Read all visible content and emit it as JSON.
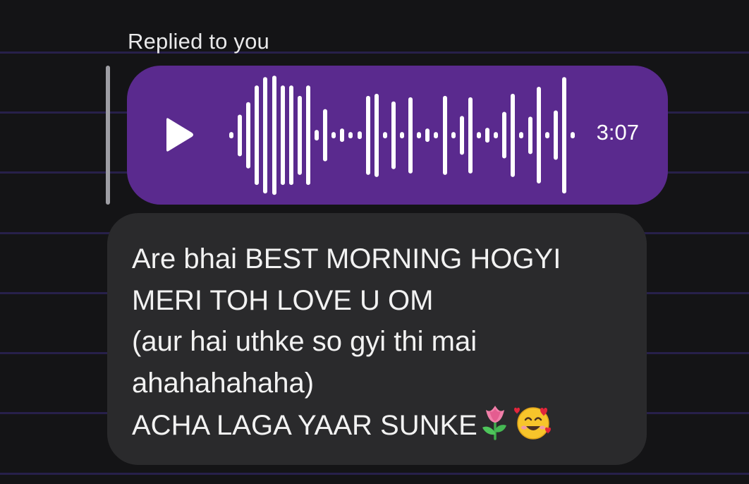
{
  "reply": {
    "label": "Replied to you"
  },
  "voice_message": {
    "duration": "3:07",
    "play_icon": "play-icon",
    "waveform_bars_level": [
      0.05,
      0.3,
      0.48,
      0.72,
      0.84,
      0.86,
      0.72,
      0.72,
      0.57,
      0.72,
      0.08,
      0.38,
      0.05,
      0.1,
      0.05,
      0.06,
      0.57,
      0.6,
      0.05,
      0.49,
      0.05,
      0.55,
      0.05,
      0.1,
      0.05,
      0.57,
      0.05,
      0.28,
      0.55,
      0.05,
      0.11,
      0.05,
      0.34,
      0.6,
      0.05,
      0.27,
      0.7,
      0.05,
      0.36,
      0.84,
      0.05
    ]
  },
  "message": {
    "lines": [
      "Are bhai BEST MORNING HOGYI",
      "MERI TOH LOVE U OM",
      "(aur hai uthke so gyi thi mai",
      "ahahahahaha)",
      "ACHA LAGA YAAR SUNKE"
    ],
    "emojis": [
      "tulip-emoji-icon",
      "smiling-face-with-hearts-emoji-icon"
    ]
  },
  "colors": {
    "background": "#141416",
    "background_lines": "#27204a",
    "voice_bubble": "#5a2a8e",
    "text_bubble": "#2a2a2c",
    "text": "#f2f2f2"
  }
}
